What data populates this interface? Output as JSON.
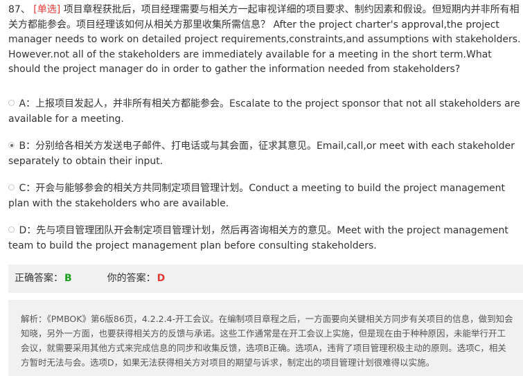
{
  "question": {
    "number": "87、",
    "type": "[单选]",
    "text": "项目章程获批后，项目经理需要与相关方一起审视详细的项目要求、制约因素和假设。但短期内并非所有相关方都能参会。项目经理该如何从相关方那里收集所需信息？ After the project charter's approval,the project manager needs to work on detailed project requirements,constraints,and assumptions with stakeholders. However.not all of the stakeholders are immediately available for a meeting in the short term.What should the project manager do in order to gather the information needed from stakeholders?"
  },
  "options": [
    {
      "label": "A：",
      "text": "上报项目发起人，并非所有相关方都能参会。Escalate to the project sponsor that not all stakeholders are available for a meeting.",
      "selected": false
    },
    {
      "label": "B：",
      "text": "分别给各相关方发送电子邮件、打电话或与其会面，征求其意见。Email,call,or meet with each stakeholder separately to obtain their input.",
      "selected": true
    },
    {
      "label": "C：",
      "text": "开会与能够参会的相关方共同制定项目管理计划。Conduct a meeting to build the project management plan with the stakeholders who are available.",
      "selected": false
    },
    {
      "label": "D：",
      "text": "先与项目管理团队开会制定项目管理计划，然后再咨询相关方的意见。Meet with the project management team to build the project management plan before consulting stakeholders.",
      "selected": false
    }
  ],
  "answer": {
    "correct_label": "正确答案：",
    "correct_value": "B",
    "yours_label": "你的答案：",
    "yours_value": "D"
  },
  "analysis": {
    "text": "解析：《PMBOK》第6版86页，4.2.2.4-开工会议。在编制项目章程之后，一方面要向关键相关方同步有关项目的信息，做到知会知晓，另外一方面，也要获得相关方的反馈与承诺。这些工作通常是在开工会议上实施，但是现在由于种种原因，未能举行开工会议，就需要采用其他方式来完成信息的同步和收集反馈，选项B正确。选项A，违背了项目管理积极主动的原则。选项C，相关方暂时无法与会。选项D，如果无法获得相关方对项目的期望与诉求，制定出的项目管理计划很难得以实施。"
  }
}
